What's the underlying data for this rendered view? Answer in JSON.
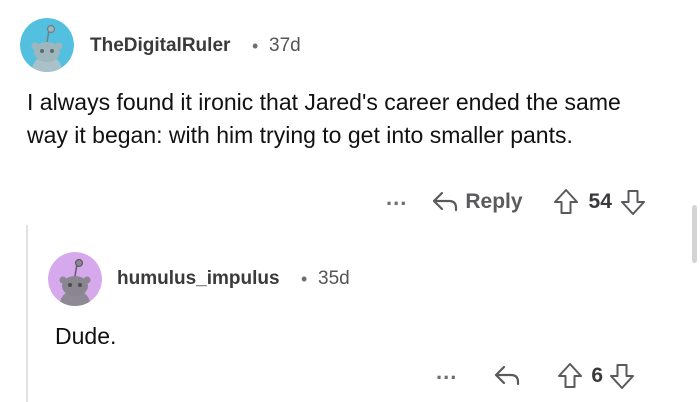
{
  "comments": [
    {
      "username": "TheDigitalRuler",
      "separator": "•",
      "age": "37d",
      "avatar_color": "#53c0e0",
      "text": "I always found it ironic that Jared's career ended the same way it began: with him trying to get into smaller pants.",
      "more_label": "...",
      "reply_label": "Reply",
      "votes": "54"
    },
    {
      "username": "humulus_impulus",
      "separator": "•",
      "age": "35d",
      "avatar_color": "#d6a8ec",
      "text": "Dude.",
      "more_label": "...",
      "reply_label": "",
      "votes": "6"
    }
  ]
}
